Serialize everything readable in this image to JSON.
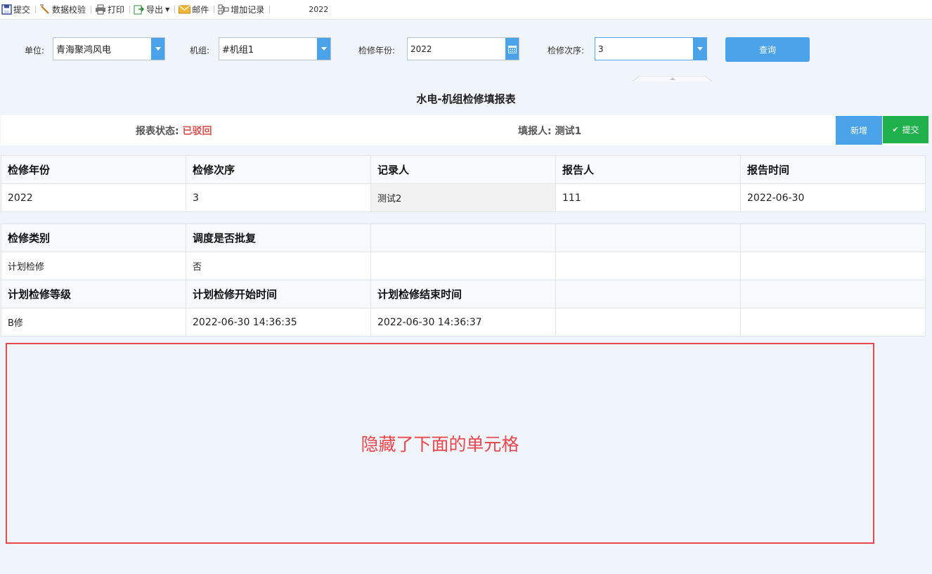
{
  "toolbar": {
    "submit": "提交",
    "validate": "数据校验",
    "print": "打印",
    "export": "导出",
    "mail": "邮件",
    "add_record": "增加记录",
    "year": "2022"
  },
  "filters": {
    "unit_label": "单位:",
    "unit_value": "青海聚鸿风电",
    "machine_label": "机组:",
    "machine_value": "#机组1",
    "year_label": "检修年份:",
    "year_value": "2022",
    "order_label": "检修次序:",
    "order_value": "3",
    "query_label": "查询"
  },
  "report": {
    "title": "水电-机组检修填报表",
    "status_label": "报表状态:",
    "status_value": "已驳回",
    "filler_label": "填报人:",
    "filler_value": "测试1",
    "add_label": "新增",
    "submit_label": "提交"
  },
  "table1": {
    "headers": [
      "检修年份",
      "检修次序",
      "记录人",
      "报告人",
      "报告时间"
    ],
    "values": [
      "2022",
      "3",
      "测试2",
      "111",
      "2022-06-30"
    ]
  },
  "table2": {
    "headers1": [
      "检修类别",
      "调度是否批复",
      "",
      "",
      ""
    ],
    "values1": [
      "计划检修",
      "否",
      "",
      "",
      ""
    ],
    "headers2": [
      "计划检修等级",
      "计划检修开始时间",
      "计划检修结束时间",
      "",
      ""
    ],
    "values2": [
      "B修",
      "2022-06-30 14:36:35",
      "2022-06-30 14:36:37",
      "",
      ""
    ]
  },
  "annotation": "隐藏了下面的单元格",
  "colors": {
    "accent_blue": "#4aa3e8",
    "submit_green": "#1fb14b",
    "status_red": "#d9534f",
    "annotation_red": "#e8474d"
  }
}
